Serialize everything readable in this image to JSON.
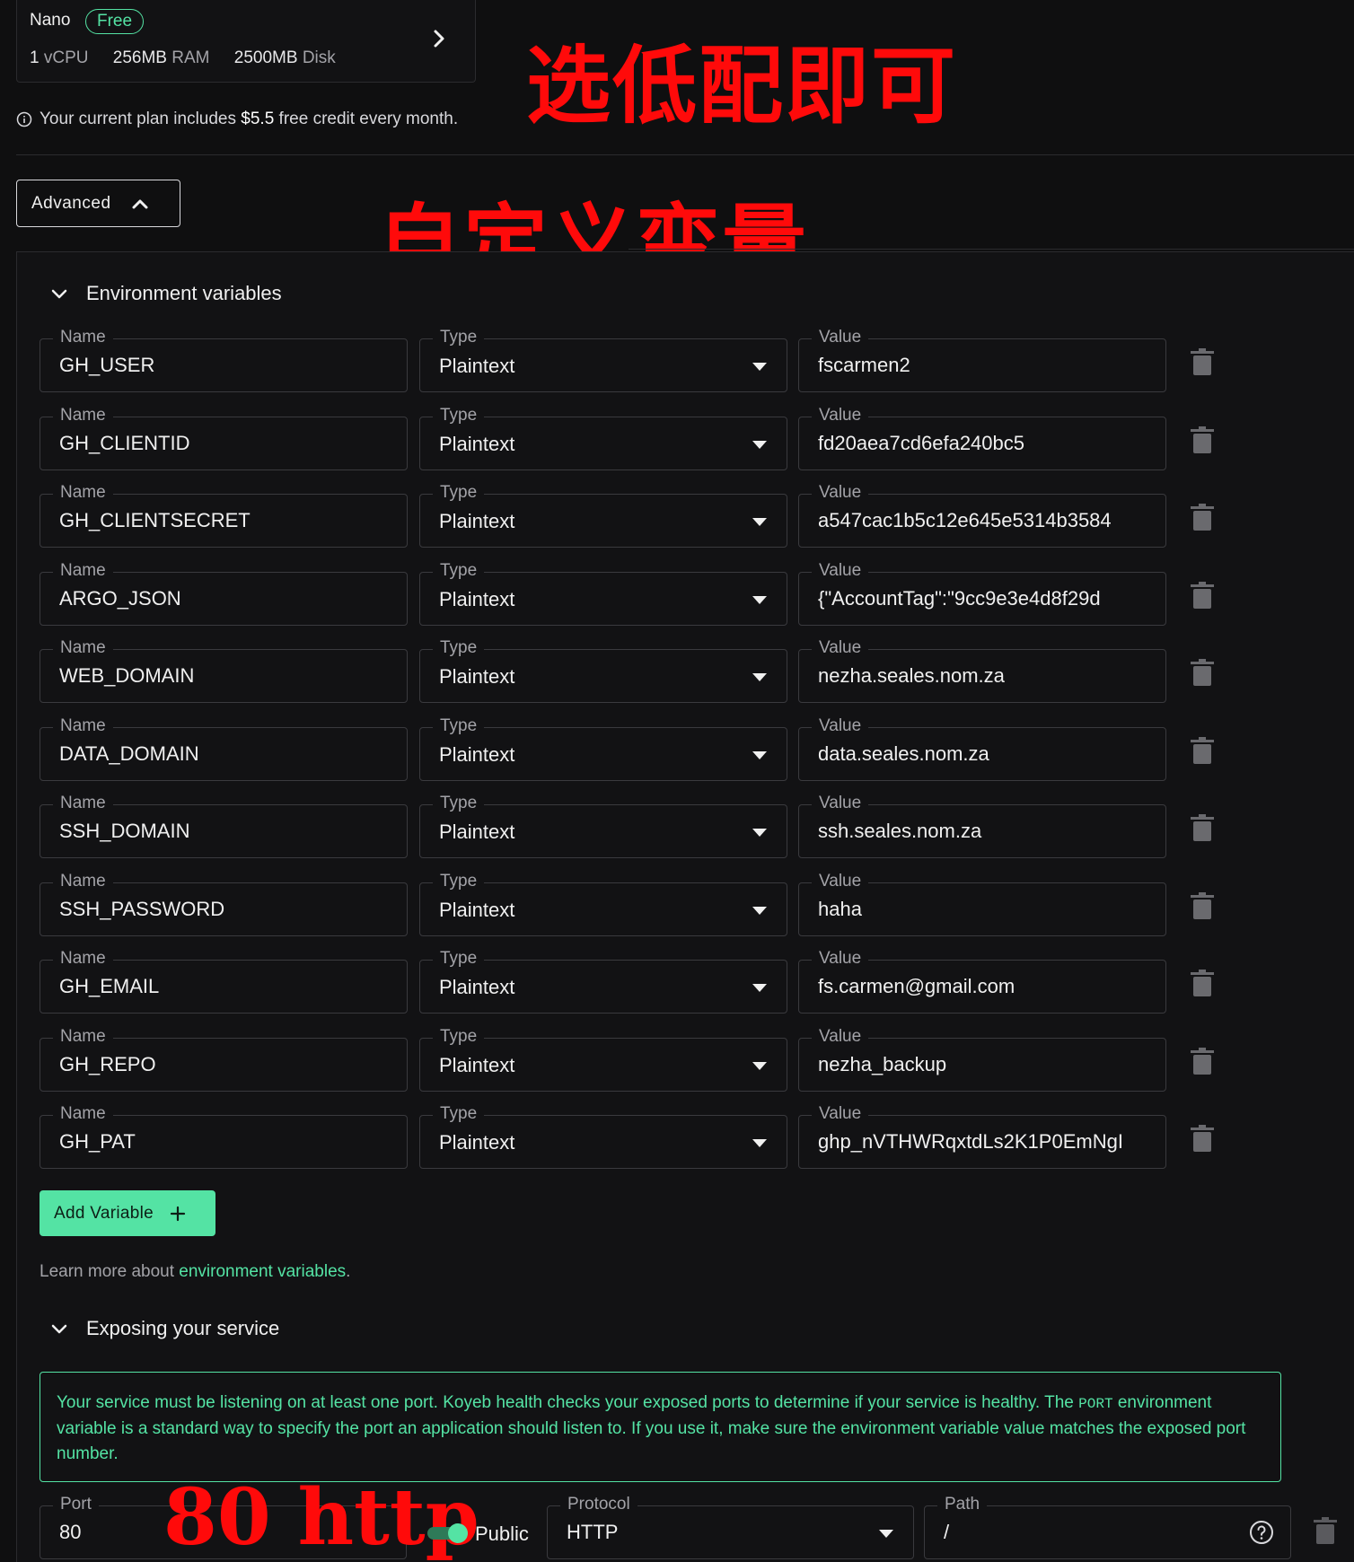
{
  "plan": {
    "name": "Nano",
    "badge": "Free",
    "cpu_value": "1",
    "cpu_unit": "vCPU",
    "ram_value": "256MB",
    "ram_unit": "RAM",
    "disk_value": "2500MB",
    "disk_unit": "Disk"
  },
  "credit_note": {
    "prefix": "Your current plan includes ",
    "amount": "$5.5",
    "suffix": " free credit every month."
  },
  "advanced_button": "Advanced",
  "env": {
    "title": "Environment variables",
    "name_label": "Name",
    "type_label": "Type",
    "value_label": "Value",
    "rows": [
      {
        "name": "GH_USER",
        "type": "Plaintext",
        "value": "fscarmen2"
      },
      {
        "name": "GH_CLIENTID",
        "type": "Plaintext",
        "value": "fd20aea7cd6efa240bc5"
      },
      {
        "name": "GH_CLIENTSECRET",
        "type": "Plaintext",
        "value": "a547cac1b5c12e645e5314b3584"
      },
      {
        "name": "ARGO_JSON",
        "type": "Plaintext",
        "value": "{\"AccountTag\":\"9cc9e3e4d8f29d"
      },
      {
        "name": "WEB_DOMAIN",
        "type": "Plaintext",
        "value": "nezha.seales.nom.za"
      },
      {
        "name": "DATA_DOMAIN",
        "type": "Plaintext",
        "value": "data.seales.nom.za"
      },
      {
        "name": "SSH_DOMAIN",
        "type": "Plaintext",
        "value": "ssh.seales.nom.za"
      },
      {
        "name": "SSH_PASSWORD",
        "type": "Plaintext",
        "value": "haha"
      },
      {
        "name": "GH_EMAIL",
        "type": "Plaintext",
        "value": "fs.carmen@gmail.com"
      },
      {
        "name": "GH_REPO",
        "type": "Plaintext",
        "value": "nezha_backup"
      },
      {
        "name": "GH_PAT",
        "type": "Plaintext",
        "value": "ghp_nVTHWRqxtdLs2K1P0EmNgI"
      }
    ],
    "add_button": "Add Variable",
    "learn_prefix": "Learn more about ",
    "learn_link": "environment variables",
    "learn_suffix": "."
  },
  "expose": {
    "title": "Exposing your service",
    "info_part1": "Your service must be listening on at least one port. Koyeb health checks your exposed ports to determine if your service is healthy. The ",
    "info_code": "PORT",
    "info_part2": " environment variable is a standard way to specify the port an application should listen to. If you use it, make sure the environment variable value matches the exposed port number.",
    "port_label": "Port",
    "port_value": "80",
    "public_label": "Public",
    "public_on": true,
    "protocol_label": "Protocol",
    "protocol_value": "HTTP",
    "path_label": "Path",
    "path_value": "/"
  },
  "annotations": {
    "plan_note": "选低配即可",
    "advanced_note": "自定义变量",
    "port_note": "80 http"
  },
  "colors": {
    "accent": "#54e3a4",
    "background": "#0f0f10",
    "annotation": "#ff0a0a"
  }
}
